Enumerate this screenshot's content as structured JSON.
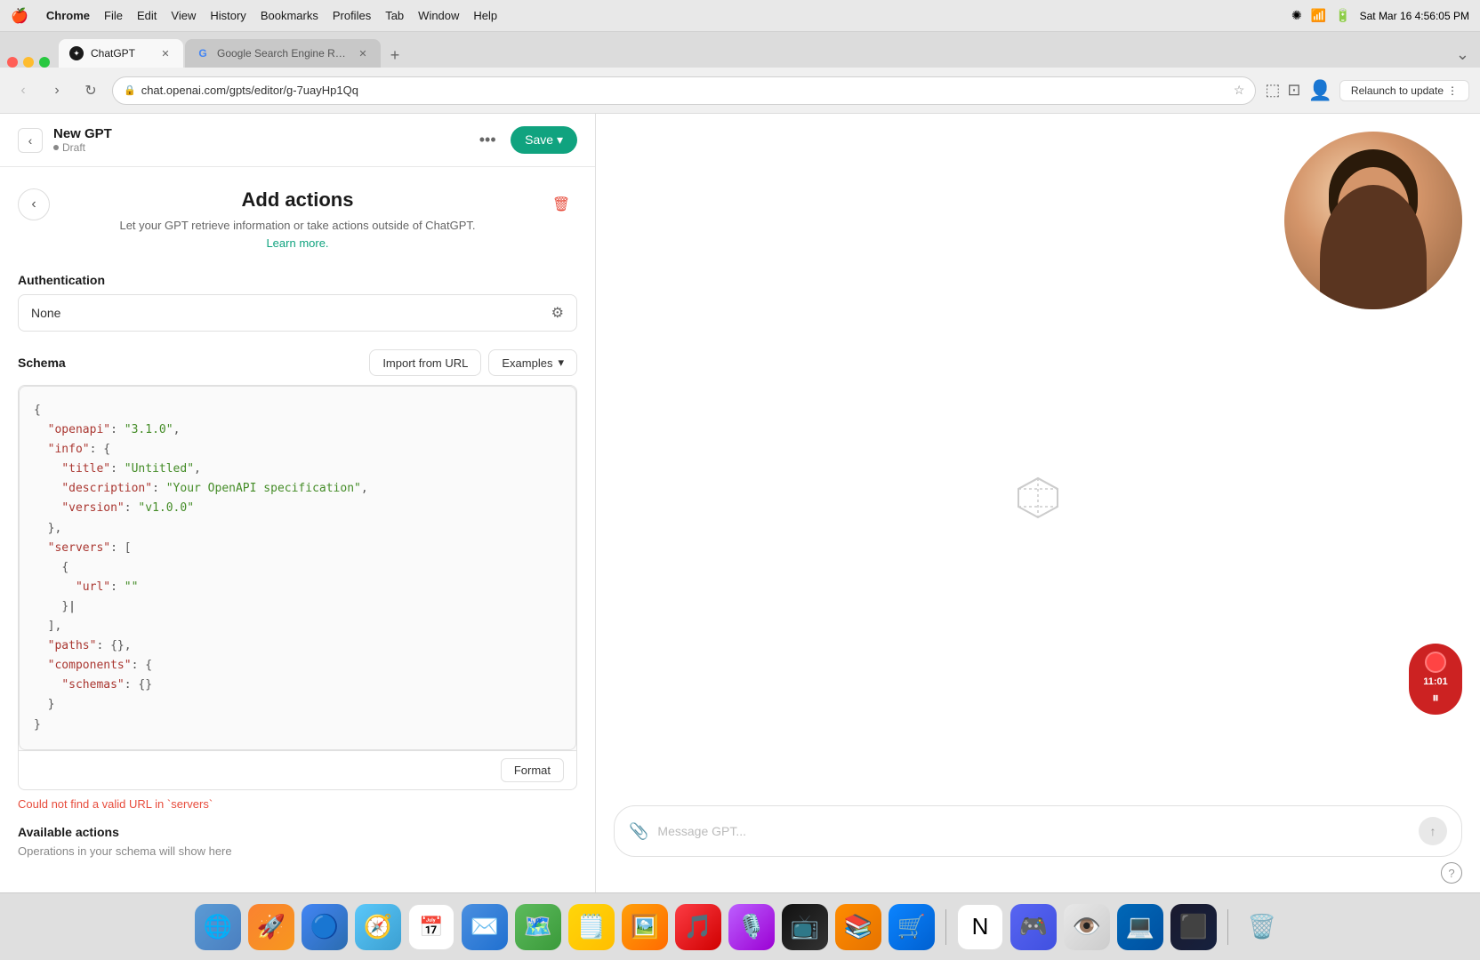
{
  "menubar": {
    "apple": "🍎",
    "chrome": "Chrome",
    "items": [
      "File",
      "Edit",
      "View",
      "History",
      "Bookmarks",
      "Profiles",
      "Tab",
      "Window",
      "Help"
    ],
    "time": "Sat Mar 16  4:56:05 PM"
  },
  "tabs": [
    {
      "id": "chatgpt",
      "label": "ChatGPT",
      "active": true,
      "favicon_type": "chatgpt"
    },
    {
      "id": "google",
      "label": "Google Search Engine Resul...",
      "active": false,
      "favicon_type": "google"
    }
  ],
  "browser": {
    "url": "chat.openai.com/gpts/editor/g-7uayHp1Qq",
    "relaunch_label": "Relaunch to update"
  },
  "gpt": {
    "back_label": "‹",
    "name": "New GPT",
    "status": "Draft",
    "more_label": "•••",
    "save_label": "Save ▾"
  },
  "add_actions": {
    "back_label": "‹",
    "title": "Add actions",
    "description": "Let your GPT retrieve information or take actions outside of ChatGPT.",
    "learn_more": "Learn more.",
    "delete_icon": "🗑"
  },
  "authentication": {
    "label": "Authentication",
    "value": "None",
    "gear_icon": "⚙"
  },
  "schema": {
    "label": "Schema",
    "import_url_label": "Import from URL",
    "examples_label": "Examples",
    "code": "{\n  \"openapi\": \"3.1.0\",\n  \"info\": {\n    \"title\": \"Untitled\",\n    \"description\": \"Your OpenAPI specification\",\n    \"version\": \"v1.0.0\"\n  },\n  \"servers\": [\n    {\n      \"url\": \"\"\n    }\n  ],\n  \"paths\": {},\n  \"components\": {\n    \"schemas\": {}\n  }\n}",
    "format_label": "Format",
    "error": "Could not find a valid URL in `servers`"
  },
  "available_actions": {
    "title": "Available actions",
    "description": "Operations in your schema will show here"
  },
  "chat": {
    "placeholder": "Message GPT...",
    "help_icon": "?"
  },
  "recording": {
    "time": "11:01"
  }
}
